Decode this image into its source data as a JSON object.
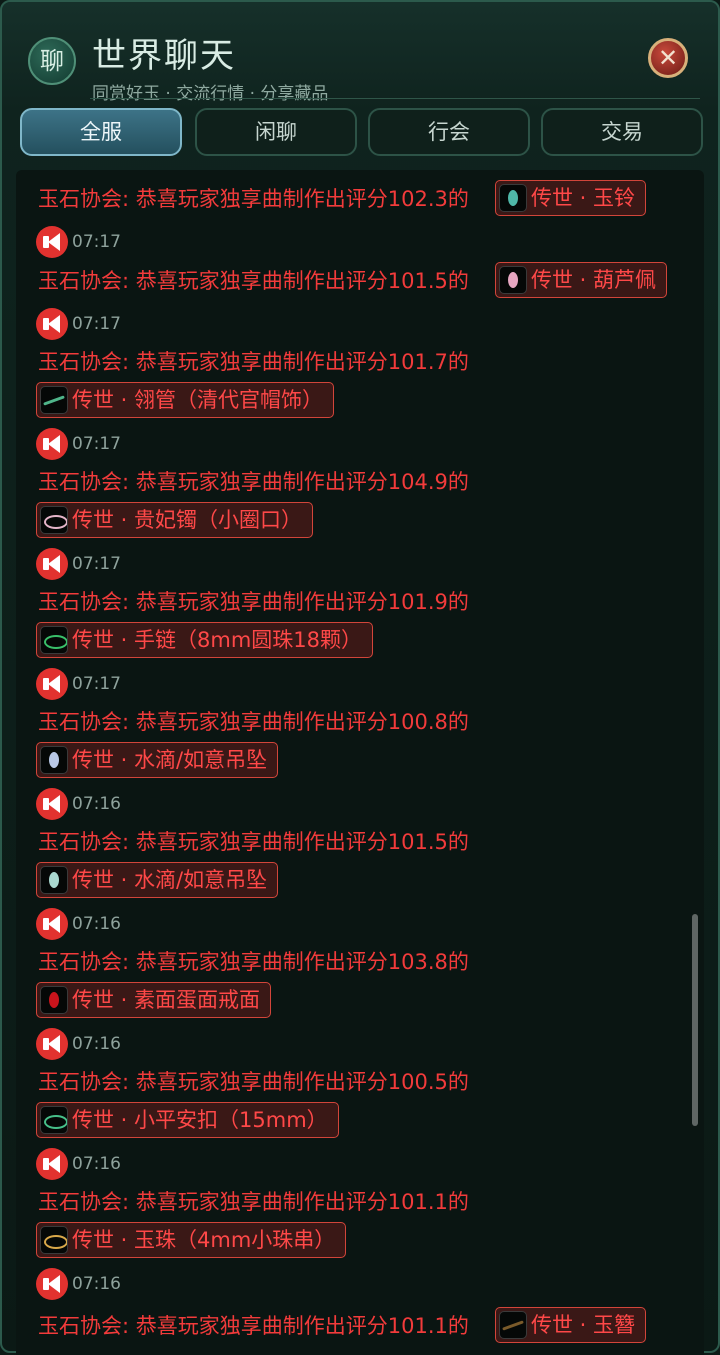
{
  "header": {
    "logo_char": "聊",
    "title": "世界聊天",
    "subtitle": "同赏好玉 · 交流行情 · 分享藏品",
    "close_symbol": "✕"
  },
  "tabs": [
    {
      "label": "全服",
      "active": true
    },
    {
      "label": "闲聊",
      "active": false
    },
    {
      "label": "行会",
      "active": false
    },
    {
      "label": "交易",
      "active": false
    }
  ],
  "messages": [
    {
      "text": "玉石协会: 恭喜玩家独享曲制作出评分102.3的",
      "item": "传世 · 玉铃",
      "icon": "jade-bell-icon",
      "time": "07:17"
    },
    {
      "text": "玉石协会: 恭喜玩家独享曲制作出评分101.5的",
      "item": "传世 · 葫芦佩",
      "icon": "gourd-pendant-icon",
      "time": "07:17"
    },
    {
      "text": "玉石协会: 恭喜玩家独享曲制作出评分101.7的",
      "item": "传世 · 翎管（清代官帽饰）",
      "icon": "feather-tube-icon",
      "time": "07:17"
    },
    {
      "text": "玉石协会: 恭喜玩家独享曲制作出评分104.9的",
      "item": "传世 · 贵妃镯（小圈口）",
      "icon": "bangle-icon",
      "time": "07:17"
    },
    {
      "text": "玉石协会: 恭喜玩家独享曲制作出评分101.9的",
      "item": "传世 · 手链（8mm圆珠18颗）",
      "icon": "bead-bracelet-icon",
      "time": "07:17"
    },
    {
      "text": "玉石协会: 恭喜玩家独享曲制作出评分100.8的",
      "item": "传世 · 水滴/如意吊坠",
      "icon": "water-drop-pendant-icon",
      "time": "07:16"
    },
    {
      "text": "玉石协会: 恭喜玩家独享曲制作出评分101.5的",
      "item": "传世 · 水滴/如意吊坠",
      "icon": "water-drop-pendant-icon",
      "time": "07:16"
    },
    {
      "text": "玉石协会: 恭喜玩家独享曲制作出评分103.8的",
      "item": "传世 · 素面蛋面戒面",
      "icon": "cabochon-icon",
      "time": "07:16"
    },
    {
      "text": "玉石协会: 恭喜玩家独享曲制作出评分100.5的",
      "item": "传世 · 小平安扣（15mm）",
      "icon": "donut-pendant-icon",
      "time": "07:16"
    },
    {
      "text": "玉石协会: 恭喜玩家独享曲制作出评分101.1的",
      "item": "传世 · 玉珠（4mm小珠串）",
      "icon": "small-bead-strand-icon",
      "time": "07:16"
    },
    {
      "text": "玉石协会: 恭喜玩家独享曲制作出评分101.1的",
      "item": "传世 · 玉簪",
      "icon": "hairpin-icon"
    }
  ],
  "colors": {
    "message_text": "#f23b3b",
    "chip_border": "#d2453a",
    "timestamp": "#8ea29c",
    "active_tab": "#3d7387"
  }
}
